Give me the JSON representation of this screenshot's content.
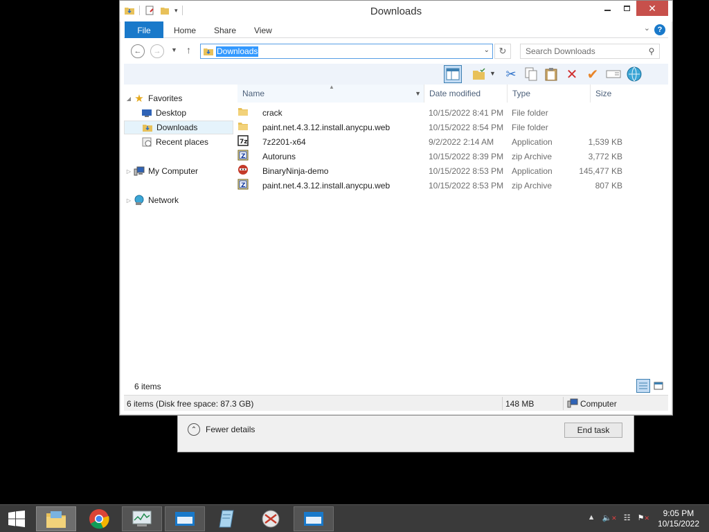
{
  "window": {
    "title": "Downloads"
  },
  "ribbon": {
    "tabs": [
      "File",
      "Home",
      "Share",
      "View"
    ],
    "help_label": "?"
  },
  "address": {
    "path": "Downloads",
    "search_placeholder": "Search Downloads"
  },
  "nav_pane": {
    "favorites": "Favorites",
    "items": [
      "Desktop",
      "Downloads",
      "Recent places"
    ],
    "computer": "My Computer",
    "network": "Network"
  },
  "columns": {
    "name": "Name",
    "date": "Date modified",
    "type": "Type",
    "size": "Size"
  },
  "files": [
    {
      "name": "crack",
      "date": "10/15/2022 8:41 PM",
      "type": "File folder",
      "size": "",
      "icon": "folder-icon"
    },
    {
      "name": "paint.net.4.3.12.install.anycpu.web",
      "date": "10/15/2022 8:54 PM",
      "type": "File folder",
      "size": "",
      "icon": "folder-icon"
    },
    {
      "name": "7z2201-x64",
      "date": "9/2/2022 2:14 AM",
      "type": "Application",
      "size": "1,539 KB",
      "icon": "7zip-icon"
    },
    {
      "name": "Autoruns",
      "date": "10/15/2022 8:39 PM",
      "type": "zip Archive",
      "size": "3,772 KB",
      "icon": "zip-icon"
    },
    {
      "name": "BinaryNinja-demo",
      "date": "10/15/2022 8:53 PM",
      "type": "Application",
      "size": "145,477 KB",
      "icon": "binaryninja-icon"
    },
    {
      "name": "paint.net.4.3.12.install.anycpu.web",
      "date": "10/15/2022 8:53 PM",
      "type": "zip Archive",
      "size": "807 KB",
      "icon": "zip-icon"
    }
  ],
  "footer": {
    "item_count": "6 items"
  },
  "statusbar": {
    "left": "6 items (Disk free space: 87.3 GB)",
    "size": "148 MB",
    "location": "Computer"
  },
  "taskmgr": {
    "fewer_details": "Fewer details",
    "end_task": "End task"
  },
  "clock": {
    "time": "9:05 PM",
    "date": "10/15/2022"
  },
  "colors": {
    "accent": "#1979ca",
    "close": "#c7504b",
    "selection": "#3399ff"
  }
}
